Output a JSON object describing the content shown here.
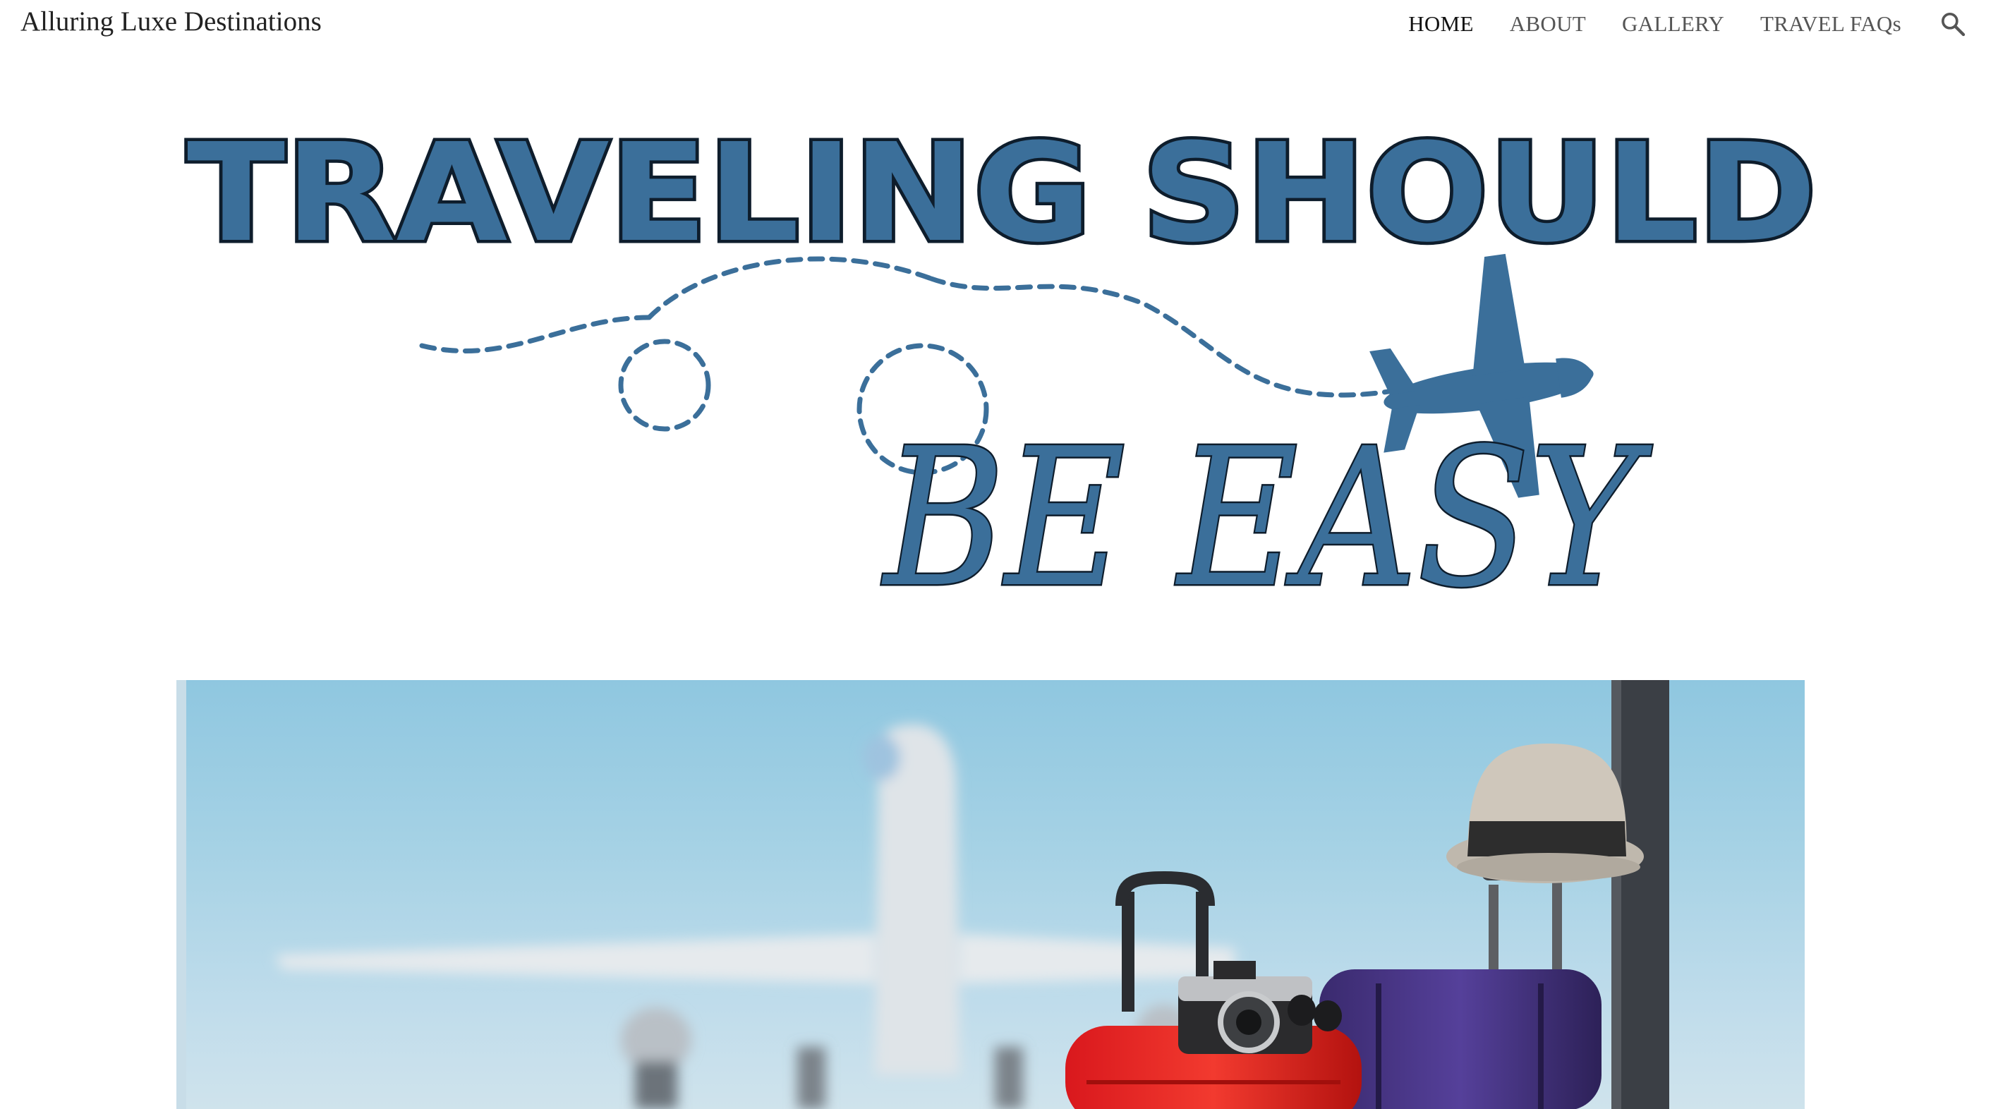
{
  "site": {
    "title": "Alluring Luxe Destinations"
  },
  "nav": {
    "items": [
      {
        "label": "HOME",
        "active": true
      },
      {
        "label": "ABOUT",
        "active": false
      },
      {
        "label": "GALLERY",
        "active": false
      },
      {
        "label": "TRAVEL FAQs",
        "active": false
      }
    ],
    "search_icon": "search-icon"
  },
  "hero": {
    "line1": "TRAVELING SHOULD",
    "line2": "BE EASY",
    "plane_icon": "airplane-icon"
  },
  "colors": {
    "brand_blue": "#3b6f9a",
    "outline": "#0e1d2c",
    "sky": "#a6d2e5"
  }
}
